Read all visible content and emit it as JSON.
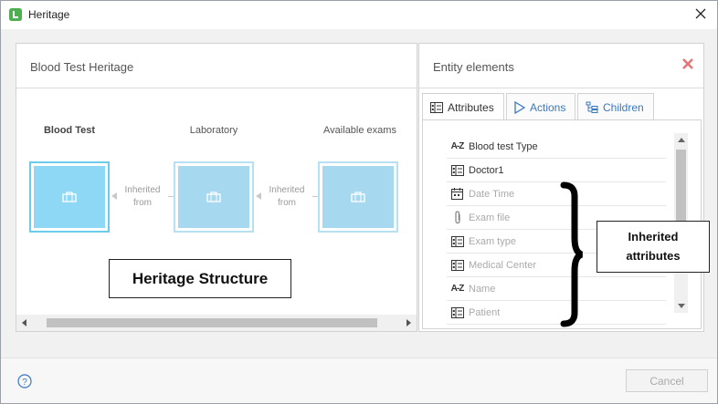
{
  "window": {
    "title": "Heritage",
    "brand_color": "#4caf50"
  },
  "left_panel": {
    "title": "Blood Test Heritage",
    "nodes": [
      {
        "label": "Blood Test"
      },
      {
        "label": "Laboratory"
      },
      {
        "label": "Available exams"
      }
    ],
    "inherit_line1": "Inherited",
    "inherit_line2": "from",
    "callout": "Heritage Structure"
  },
  "right_panel": {
    "title": "Entity elements",
    "tabs": [
      {
        "label": "Attributes",
        "icon": "attributes-icon"
      },
      {
        "label": "Actions",
        "icon": "play-icon"
      },
      {
        "label": "Children",
        "icon": "hierarchy-icon"
      }
    ],
    "attributes": [
      {
        "name": "Blood test Type",
        "icon": "az-icon",
        "inherited": false
      },
      {
        "name": "Doctor1",
        "icon": "entity-icon",
        "inherited": false
      },
      {
        "name": "Date Time",
        "icon": "calendar-icon",
        "inherited": true
      },
      {
        "name": "Exam file",
        "icon": "attachment-icon",
        "inherited": true
      },
      {
        "name": "Exam type",
        "icon": "entity-icon",
        "inherited": true
      },
      {
        "name": "Medical Center",
        "icon": "entity-icon",
        "inherited": true
      },
      {
        "name": "Name",
        "icon": "az-icon",
        "inherited": true
      },
      {
        "name": "Patient",
        "icon": "entity-icon",
        "inherited": true
      }
    ],
    "az_glyph": "A-Z",
    "callout_line1": "Inherited",
    "callout_line2": "attributes"
  },
  "footer": {
    "help_glyph": "?",
    "cancel_label": "Cancel"
  },
  "colors": {
    "accent_link": "#3a78c2",
    "node_fill": "#a6d8ef",
    "remove_x": "#e57373"
  }
}
